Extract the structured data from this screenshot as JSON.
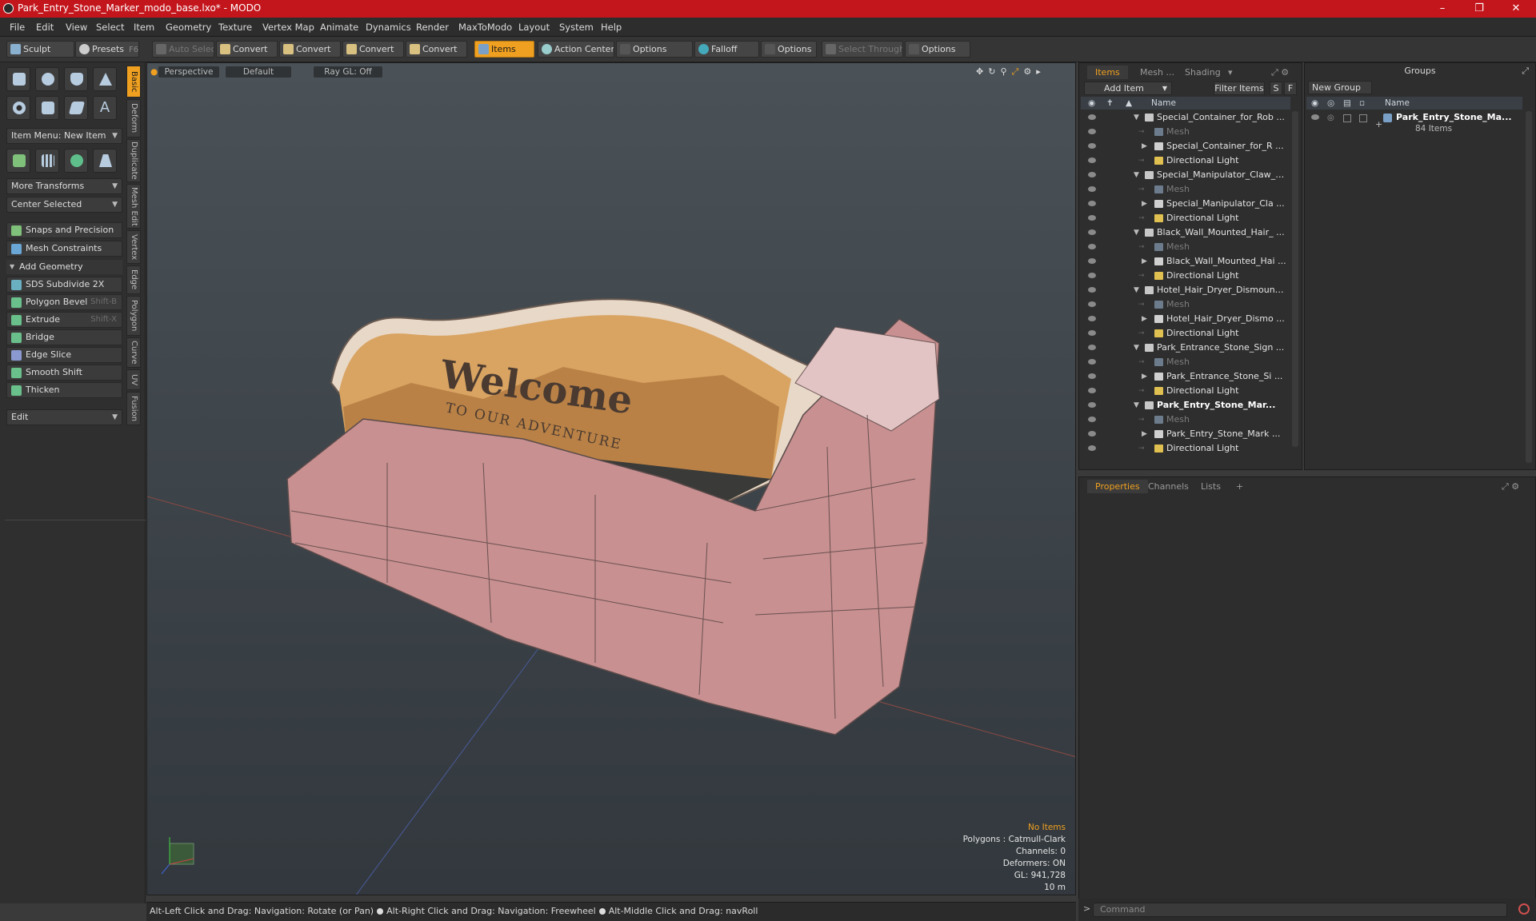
{
  "window": {
    "title": "Park_Entry_Stone_Marker_modo_base.lxo* - MODO"
  },
  "menu": [
    "File",
    "Edit",
    "View",
    "Select",
    "Item",
    "Geometry",
    "Texture",
    "Vertex Map",
    "Animate",
    "Dynamics",
    "Render",
    "MaxToModo",
    "Layout",
    "System",
    "Help"
  ],
  "toolbar": {
    "sculpt": "Sculpt",
    "presets": "Presets",
    "presets_shortcut": "F6",
    "auto_select": "Auto Select",
    "convert": "Convert",
    "items": "Items",
    "action_center": "Action Center",
    "options": "Options",
    "falloff": "Falloff",
    "select_through": "Select Through"
  },
  "left": {
    "item_menu": "Item Menu: New Item",
    "more_transforms": "More Transforms",
    "center_selected": "Center Selected",
    "snaps": "Snaps and Precision",
    "mesh_constraints": "Mesh Constraints",
    "add_geometry": "Add Geometry",
    "tools": [
      {
        "label": "SDS Subdivide 2X",
        "shortcut": ""
      },
      {
        "label": "Polygon Bevel",
        "shortcut": "Shift-B"
      },
      {
        "label": "Extrude",
        "shortcut": "Shift-X"
      },
      {
        "label": "Bridge",
        "shortcut": ""
      },
      {
        "label": "Edge Slice",
        "shortcut": ""
      },
      {
        "label": "Smooth Shift",
        "shortcut": ""
      },
      {
        "label": "Thicken",
        "shortcut": ""
      }
    ],
    "edit": "Edit",
    "vtabs": [
      "Basic",
      "Deform",
      "Duplicate",
      "Mesh Edit",
      "Vertex",
      "Edge",
      "Polygon",
      "Curve",
      "UV",
      "Fusion"
    ]
  },
  "viewport": {
    "view": "Perspective",
    "shading": "Default",
    "raygl": "Ray GL: Off",
    "sign_line1": "Welcome",
    "sign_line2": "TO OUR ADVENTURE",
    "stats": {
      "no_items": "No Items",
      "polygons": "Polygons : Catmull-Clark",
      "channels": "Channels: 0",
      "deformers": "Deformers: ON",
      "gl": "GL: 941,728",
      "scale": "10 m"
    }
  },
  "status": {
    "hint1": "Alt-Left Click and Drag: Navigation: Rotate (or Pan)",
    "hint2": "Alt-Right Click and Drag: Navigation: Freewheel",
    "hint3": "Alt-Middle Click and Drag: navRoll"
  },
  "items_panel": {
    "tabs": [
      "Items",
      "Mesh ...",
      "Shading"
    ],
    "add_item": "Add Item",
    "filter_items": "Filter Items",
    "s": "S",
    "f": "F",
    "col_name": "Name",
    "rows": [
      {
        "label": "Special_Container_for_Rob ...",
        "type": "grp"
      },
      {
        "label": "Mesh",
        "type": "mesh"
      },
      {
        "label": "Special_Container_for_R ...",
        "type": "sub"
      },
      {
        "label": "Directional Light",
        "type": "light"
      },
      {
        "label": "Special_Manipulator_Claw_ ...",
        "type": "grp"
      },
      {
        "label": "Mesh",
        "type": "mesh"
      },
      {
        "label": "Special_Manipulator_Cla ...",
        "type": "sub"
      },
      {
        "label": "Directional Light",
        "type": "light"
      },
      {
        "label": "Black_Wall_Mounted_Hair_ ...",
        "type": "grp"
      },
      {
        "label": "Mesh",
        "type": "mesh"
      },
      {
        "label": "Black_Wall_Mounted_Hai ...",
        "type": "sub"
      },
      {
        "label": "Directional Light",
        "type": "light"
      },
      {
        "label": "Hotel_Hair_Dryer_Dismount...",
        "type": "grp"
      },
      {
        "label": "Mesh",
        "type": "mesh"
      },
      {
        "label": "Hotel_Hair_Dryer_Dismo ...",
        "type": "sub"
      },
      {
        "label": "Directional Light",
        "type": "light"
      },
      {
        "label": "Park_Entrance_Stone_Sign ...",
        "type": "grp"
      },
      {
        "label": "Mesh",
        "type": "mesh"
      },
      {
        "label": "Park_Entrance_Stone_Si ...",
        "type": "sub"
      },
      {
        "label": "Directional Light",
        "type": "light"
      },
      {
        "label": "Park_Entry_Stone_Mar...",
        "type": "grp bold"
      },
      {
        "label": "Mesh",
        "type": "mesh"
      },
      {
        "label": "Park_Entry_Stone_Mark ...",
        "type": "sub"
      },
      {
        "label": "Directional Light",
        "type": "light"
      }
    ]
  },
  "groups_panel": {
    "title": "Groups",
    "new_group": "New Group",
    "col_name": "Name",
    "group_name": "Park_Entry_Stone_Ma...",
    "group_count": "84 Items"
  },
  "props_panel": {
    "tabs": [
      "Properties",
      "Channels",
      "Lists"
    ],
    "add": "+"
  },
  "command": {
    "placeholder": "Command"
  },
  "colors": {
    "accent": "#f0a020",
    "titlebar": "#c3161c"
  }
}
